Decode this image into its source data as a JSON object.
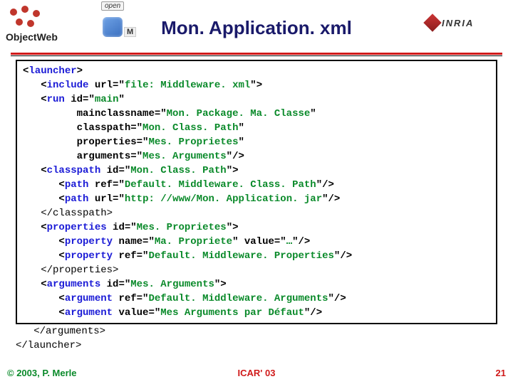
{
  "header": {
    "title": "Mon. Application. xml",
    "logo_left_text": "ObjectWeb",
    "open_label": "open",
    "mini_label": "M",
    "inria_text": "INRIA"
  },
  "code": {
    "lines": [
      {
        "indent": 0,
        "fragments": [
          {
            "t": "<",
            "b": true
          },
          {
            "t": "launcher",
            "b": true,
            "c": "blue"
          },
          {
            "t": ">",
            "b": true
          }
        ]
      },
      {
        "indent": 1,
        "fragments": [
          {
            "t": "<",
            "b": true
          },
          {
            "t": "include",
            "b": true,
            "c": "blue"
          },
          {
            "t": " url=\"",
            "b": true
          },
          {
            "t": "file: Middleware. xml",
            "b": true,
            "c": "green"
          },
          {
            "t": "\">",
            "b": true
          }
        ]
      },
      {
        "indent": 1,
        "fragments": [
          {
            "t": "<",
            "b": true
          },
          {
            "t": "run",
            "b": true,
            "c": "blue"
          },
          {
            "t": " id=\"",
            "b": true
          },
          {
            "t": "main",
            "b": true,
            "c": "green"
          },
          {
            "t": "\"",
            "b": true
          }
        ]
      },
      {
        "indent": 3,
        "fragments": [
          {
            "t": "mainclassname=\"",
            "b": true
          },
          {
            "t": "Mon. Package. Ma. Classe",
            "b": true,
            "c": "green"
          },
          {
            "t": "\"",
            "b": true
          }
        ]
      },
      {
        "indent": 3,
        "fragments": [
          {
            "t": "classpath=\"",
            "b": true
          },
          {
            "t": "Mon. Class. Path",
            "b": true,
            "c": "green"
          },
          {
            "t": "\"",
            "b": true
          }
        ]
      },
      {
        "indent": 3,
        "fragments": [
          {
            "t": "properties=\"",
            "b": true
          },
          {
            "t": "Mes. Proprietes",
            "b": true,
            "c": "green"
          },
          {
            "t": "\"",
            "b": true
          }
        ]
      },
      {
        "indent": 3,
        "fragments": [
          {
            "t": "arguments=\"",
            "b": true
          },
          {
            "t": "Mes. Arguments",
            "b": true,
            "c": "green"
          },
          {
            "t": "\"/>",
            "b": true
          }
        ]
      },
      {
        "indent": 1,
        "fragments": [
          {
            "t": "<",
            "b": true
          },
          {
            "t": "classpath",
            "b": true,
            "c": "blue"
          },
          {
            "t": " id=\"",
            "b": true
          },
          {
            "t": "Mon. Class. Path",
            "b": true,
            "c": "green"
          },
          {
            "t": "\">",
            "b": true
          }
        ]
      },
      {
        "indent": 2,
        "fragments": [
          {
            "t": "<",
            "b": true
          },
          {
            "t": "path",
            "b": true,
            "c": "blue"
          },
          {
            "t": " ref=\"",
            "b": true
          },
          {
            "t": "Default. Middleware. Class. Path",
            "b": true,
            "c": "green"
          },
          {
            "t": "\"/>",
            "b": true
          }
        ]
      },
      {
        "indent": 2,
        "fragments": [
          {
            "t": "<",
            "b": true
          },
          {
            "t": "path",
            "b": true,
            "c": "blue"
          },
          {
            "t": " url=\"",
            "b": true
          },
          {
            "t": "http: //www/Mon. Application. jar",
            "b": true,
            "c": "green"
          },
          {
            "t": "\"/>",
            "b": true
          }
        ]
      },
      {
        "indent": 1,
        "fragments": [
          {
            "t": "</classpath>",
            "b": false
          }
        ]
      },
      {
        "indent": 1,
        "fragments": [
          {
            "t": "<",
            "b": true
          },
          {
            "t": "properties",
            "b": true,
            "c": "blue"
          },
          {
            "t": " id=\"",
            "b": true
          },
          {
            "t": "Mes. Proprietes",
            "b": true,
            "c": "green"
          },
          {
            "t": "\">",
            "b": true
          }
        ]
      },
      {
        "indent": 2,
        "fragments": [
          {
            "t": "<",
            "b": true
          },
          {
            "t": "property",
            "b": true,
            "c": "blue"
          },
          {
            "t": " name=\"",
            "b": true
          },
          {
            "t": "Ma. Propriete",
            "b": true,
            "c": "green"
          },
          {
            "t": "\" value=\"",
            "b": true
          },
          {
            "t": "…",
            "b": true,
            "c": "green"
          },
          {
            "t": "\"/>",
            "b": true
          }
        ]
      },
      {
        "indent": 2,
        "fragments": [
          {
            "t": "<",
            "b": true
          },
          {
            "t": "property",
            "b": true,
            "c": "blue"
          },
          {
            "t": " ref=\"",
            "b": true
          },
          {
            "t": "Default. Middleware. Properties",
            "b": true,
            "c": "green"
          },
          {
            "t": "\"/>",
            "b": true
          }
        ]
      },
      {
        "indent": 1,
        "fragments": [
          {
            "t": "</properties>",
            "b": false
          }
        ]
      },
      {
        "indent": 1,
        "fragments": [
          {
            "t": "<",
            "b": true
          },
          {
            "t": "arguments",
            "b": true,
            "c": "blue"
          },
          {
            "t": " id=\"",
            "b": true
          },
          {
            "t": "Mes. Arguments",
            "b": true,
            "c": "green"
          },
          {
            "t": "\">",
            "b": true
          }
        ]
      },
      {
        "indent": 2,
        "fragments": [
          {
            "t": "<",
            "b": true
          },
          {
            "t": "argument",
            "b": true,
            "c": "blue"
          },
          {
            "t": " ref=\"",
            "b": true
          },
          {
            "t": "Default. Middleware. Arguments",
            "b": true,
            "c": "green"
          },
          {
            "t": "\"/>",
            "b": true
          }
        ]
      },
      {
        "indent": 2,
        "fragments": [
          {
            "t": "<",
            "b": true
          },
          {
            "t": "argument",
            "b": true,
            "c": "blue"
          },
          {
            "t": " value=\"",
            "b": true
          },
          {
            "t": "Mes Arguments par Défaut",
            "b": true,
            "c": "green"
          },
          {
            "t": "\"/>",
            "b": true
          }
        ]
      }
    ],
    "after_box": [
      {
        "indent": 1,
        "fragments": [
          {
            "t": "</arguments>",
            "b": false
          }
        ]
      },
      {
        "indent": 0,
        "fragments": [
          {
            "t": "</launcher>",
            "b": false
          }
        ]
      }
    ]
  },
  "footer": {
    "left": "© 2003, P. Merle",
    "center": "ICAR' 03",
    "right": "21"
  }
}
